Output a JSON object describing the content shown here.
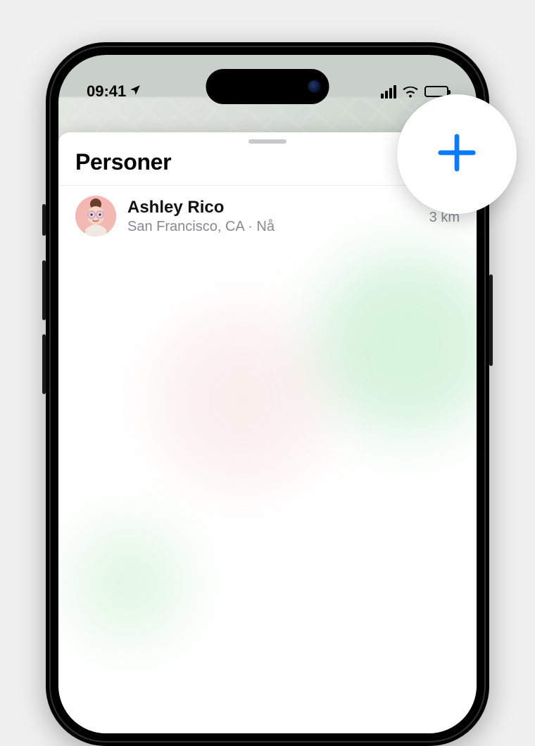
{
  "status": {
    "time": "09:41"
  },
  "sheet": {
    "title": "Personer"
  },
  "people": [
    {
      "name": "Ashley Rico",
      "subtitle": "San Francisco, CA ·  Nå",
      "distance": "3 km"
    }
  ],
  "icons": {
    "add": "plus-icon"
  },
  "colors": {
    "accent": "#0a7bff"
  }
}
